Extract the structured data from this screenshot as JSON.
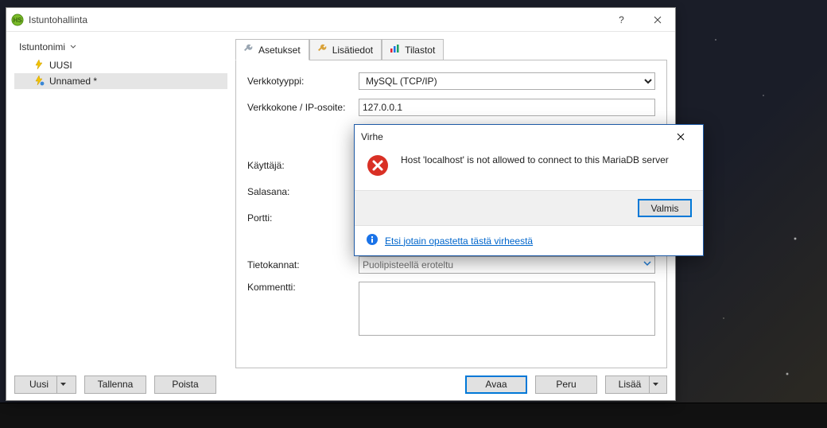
{
  "window": {
    "title": "Istuntohallinta"
  },
  "sidebar": {
    "header": "Istuntonimi",
    "items": [
      {
        "label": "UUSI"
      },
      {
        "label": "Unnamed *"
      }
    ],
    "selected_index": 1
  },
  "tabs": [
    {
      "label": "Asetukset"
    },
    {
      "label": "Lisätiedot"
    },
    {
      "label": "Tilastot"
    }
  ],
  "form": {
    "network_type_label": "Verkkotyyppi:",
    "network_type_value": "MySQL (TCP/IP)",
    "host_label": "Verkkokone / IP-osoite:",
    "host_value": "127.0.0.1",
    "user_label": "Käyttäjä:",
    "password_label": "Salasana:",
    "port_label": "Portti:",
    "databases_label": "Tietokannat:",
    "databases_placeholder": "Puolipisteellä eroteltu",
    "comment_label": "Kommentti:"
  },
  "buttons": {
    "new": "Uusi",
    "save": "Tallenna",
    "delete": "Poista",
    "open": "Avaa",
    "cancel": "Peru",
    "more": "Lisää"
  },
  "error_dialog": {
    "title": "Virhe",
    "message": "Host 'localhost' is not allowed to connect to this MariaDB server",
    "ok": "Valmis",
    "help_link": "Etsi jotain opastetta tästä virheestä"
  }
}
